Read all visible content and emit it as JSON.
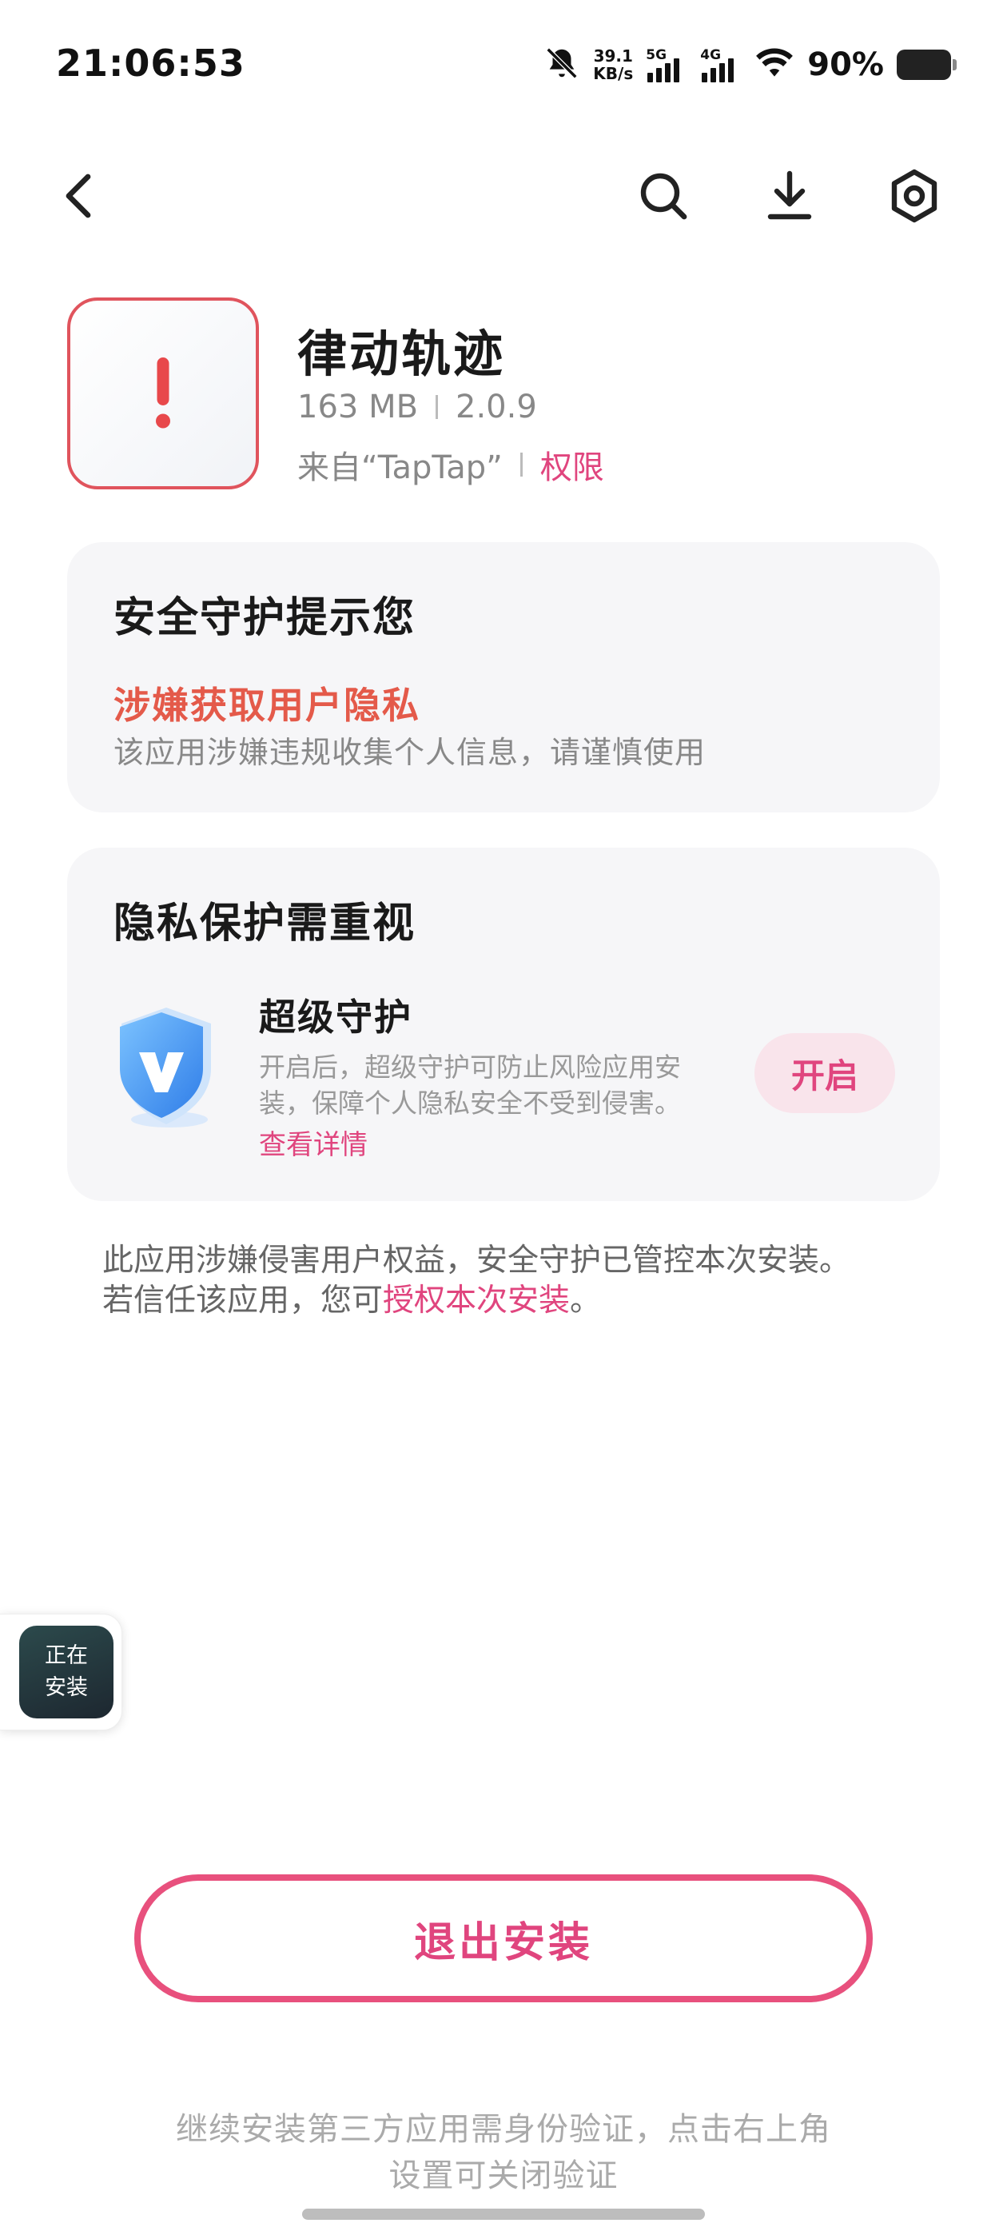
{
  "status_bar": {
    "time": "21:06:53",
    "net_speed_value": "39.1",
    "net_speed_unit": "KB/s",
    "sim1_label": "5G",
    "sim2_label": "4G",
    "battery_percent": "90%",
    "icons": [
      "bell-muted-icon",
      "signal-icon",
      "signal-icon",
      "wifi-icon",
      "battery-icon"
    ]
  },
  "nav": {
    "icons": [
      "back-arrow-icon",
      "search-icon",
      "download-icon",
      "settings-icon"
    ]
  },
  "app": {
    "name": "律动轨迹",
    "size": "163 MB",
    "version": "2.0.9",
    "source": "来自“TapTap”",
    "permissions_link": "权限",
    "icon": "warning-exclamation-icon"
  },
  "security_card": {
    "title": "安全守护提示您",
    "warning_title": "涉嫌获取用户隐私",
    "warning_desc": "该应用涉嫌违规收集个人信息，请谨慎使用"
  },
  "privacy_card": {
    "title": "隐私保护需重视",
    "feature_name": "超级守护",
    "feature_desc": "开启后，超级守护可防止风险应用安装，保障个人隐私安全不受到侵害。",
    "detail_link": "查看详情",
    "enable_button": "开启",
    "icon": "shield-v-icon"
  },
  "notice": {
    "line1": "此应用涉嫌侵害用户权益，安全守护已管控本次安装。",
    "line2_prefix": "若信任该应用，您可",
    "line2_link": "授权本次安装",
    "line2_suffix": "。"
  },
  "floating_widget": {
    "line1": "正在",
    "line2": "安装"
  },
  "exit_button": "退出安装",
  "footer_note": "继续安装第三方应用需身份验证，点击右上角设置可关闭验证",
  "colors": {
    "accent": "#e0457e",
    "warning": "#e45a4a",
    "icon_border": "#e0545d",
    "card_bg": "#f6f6f8"
  }
}
